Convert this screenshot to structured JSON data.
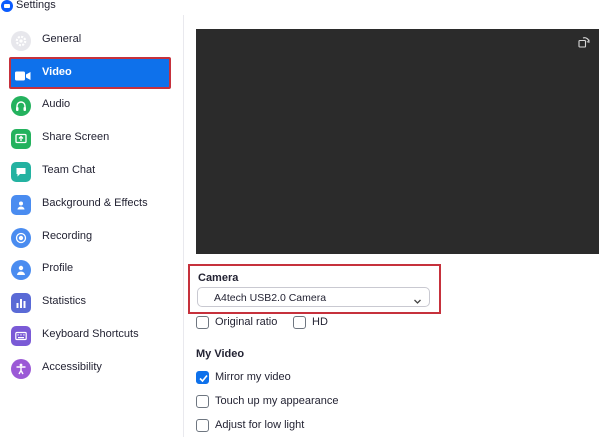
{
  "window": {
    "title": "Settings",
    "icon": "zoom-logo-icon"
  },
  "sidebar": {
    "selected_index": 1,
    "items": [
      {
        "label": "General",
        "icon": "gear-icon",
        "color": "#e7e7ec"
      },
      {
        "label": "Video",
        "icon": "video-camera-icon",
        "color": "#0e71eb"
      },
      {
        "label": "Audio",
        "icon": "headphones-icon",
        "color": "#24b25e"
      },
      {
        "label": "Share Screen",
        "icon": "share-screen-icon",
        "color": "#24b25e"
      },
      {
        "label": "Team Chat",
        "icon": "chat-bubble-icon",
        "color": "#24b2a1"
      },
      {
        "label": "Background & Effects",
        "icon": "person-background-icon",
        "color": "#4a8cf0"
      },
      {
        "label": "Recording",
        "icon": "record-icon",
        "color": "#4a8cf0"
      },
      {
        "label": "Profile",
        "icon": "profile-icon",
        "color": "#4a8cf0"
      },
      {
        "label": "Statistics",
        "icon": "bar-chart-icon",
        "color": "#5a6ad6"
      },
      {
        "label": "Keyboard Shortcuts",
        "icon": "keyboard-icon",
        "color": "#7a5ad6"
      },
      {
        "label": "Accessibility",
        "icon": "accessibility-icon",
        "color": "#9b59d6"
      }
    ]
  },
  "video": {
    "preview_icon": "rotate-icon",
    "camera_label": "Camera",
    "camera_value": "A4tech USB2.0 Camera",
    "options": {
      "original_ratio": {
        "label": "Original ratio",
        "checked": false
      },
      "hd": {
        "label": "HD",
        "checked": false
      }
    },
    "my_video_title": "My Video",
    "my_video": {
      "mirror": {
        "label": "Mirror my video",
        "checked": true
      },
      "touch_up": {
        "label": "Touch up my appearance",
        "checked": false
      },
      "low_light": {
        "label": "Adjust for low light",
        "checked": false
      }
    }
  },
  "colors": {
    "accent": "#0e71eb",
    "highlight_border": "#c6313c",
    "preview_bg": "#2b2b2b"
  }
}
